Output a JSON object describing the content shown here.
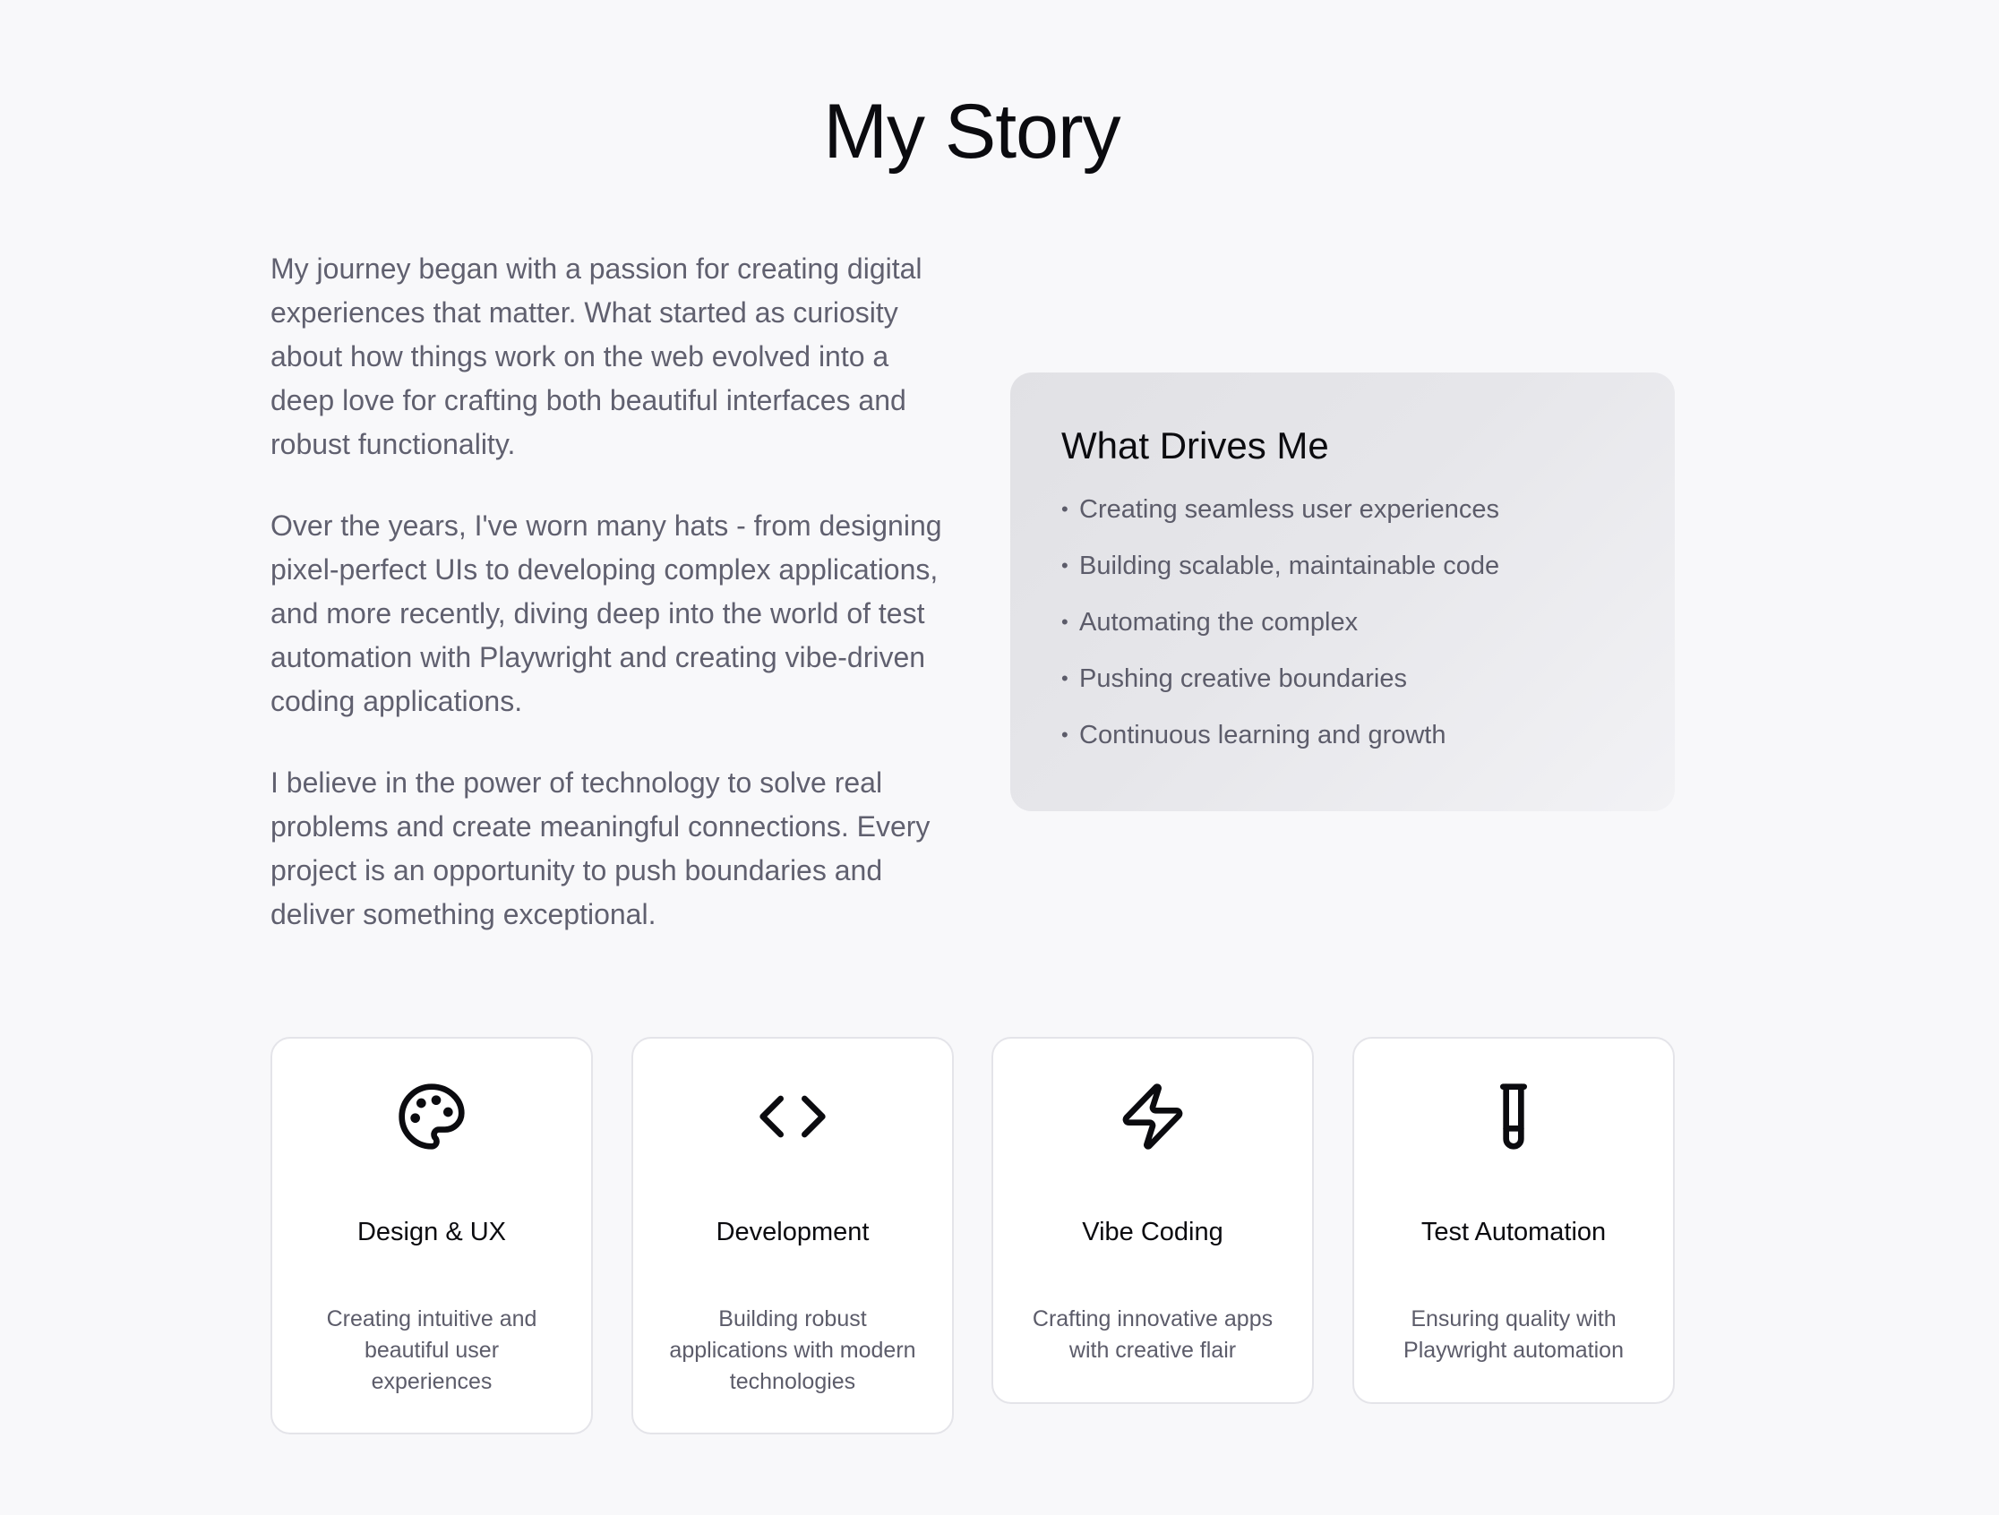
{
  "page": {
    "title": "My Story"
  },
  "story": {
    "paragraphs": [
      "My journey began with a passion for creating digital experiences that matter. What started as curiosity about how things work on the web evolved into a deep love for crafting both beautiful interfaces and robust functionality.",
      "Over the years, I've worn many hats - from designing pixel-perfect UIs to developing complex applications, and more recently, diving deep into the world of test automation with Playwright and creating vibe-driven coding applications.",
      "I believe in the power of technology to solve real problems and create meaningful connections. Every project is an opportunity to push boundaries and deliver something exceptional."
    ]
  },
  "drives": {
    "title": "What Drives Me",
    "bullet": "•",
    "items": [
      "Creating seamless user experiences",
      "Building scalable, maintainable code",
      "Automating the complex",
      "Pushing creative boundaries",
      "Continuous learning and growth"
    ]
  },
  "cards": [
    {
      "icon": "palette-icon",
      "title": "Design & UX",
      "description": "Creating intuitive and beautiful user experiences"
    },
    {
      "icon": "code-icon",
      "title": "Development",
      "description": "Building robust applications with modern technologies"
    },
    {
      "icon": "lightning-icon",
      "title": "Vibe Coding",
      "description": "Crafting innovative apps with creative flair"
    },
    {
      "icon": "test-tube-icon",
      "title": "Test Automation",
      "description": "Ensuring quality with Playwright automation"
    }
  ],
  "colors": {
    "background": "#f8f8fa",
    "heading": "#0b0b0f",
    "body_text": "#60606f",
    "card_border": "#e4e4e9"
  }
}
